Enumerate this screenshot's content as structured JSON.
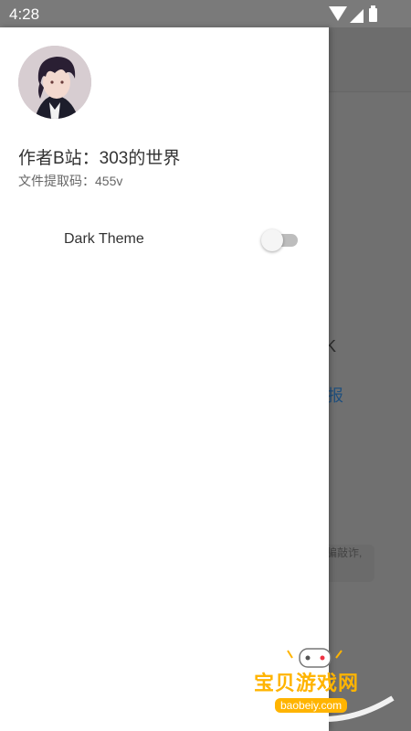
{
  "status_bar": {
    "time": "4:28"
  },
  "background": {
    "text_fragment_1": "K",
    "text_fragment_2": "报",
    "text_fragment_3": "诈骗敲诈,"
  },
  "drawer": {
    "author_name": "作者B站：303的世界",
    "extract_code": "文件提取码：455v",
    "dark_theme": {
      "label": "Dark Theme",
      "enabled": false
    }
  },
  "watermark": {
    "name_cn": "宝贝游戏网",
    "url": "baobeiy.com"
  },
  "colors": {
    "drawer_bg": "#ffffff",
    "scrim": "#707070",
    "toggle_off_track": "#bdbdbd",
    "watermark_accent": "#ffb400"
  },
  "icons": {
    "moon": "moon-icon",
    "wifi": "wifi-icon",
    "signal": "signal-icon",
    "battery": "battery-icon"
  }
}
